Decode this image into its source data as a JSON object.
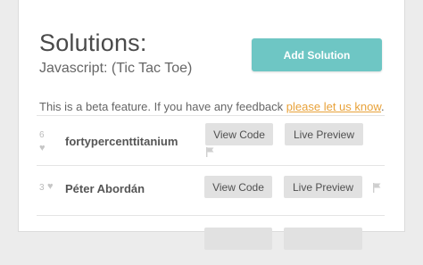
{
  "header": {
    "title": "Solutions:",
    "subtitle": "Javascript: (Tic Tac Toe)",
    "add_button": "Add Solution"
  },
  "beta": {
    "text": "This is a beta feature. If you have any feedback ",
    "link": "please let us know",
    "end": "."
  },
  "solutions": [
    {
      "votes": "6",
      "author": "fortypercenttitanium",
      "view_label": "View Code",
      "preview_label": "Live Preview"
    },
    {
      "votes": "3",
      "author": "Péter Abordán",
      "view_label": "View Code",
      "preview_label": "Live Preview"
    },
    {
      "votes": "",
      "author": "",
      "view_label": "",
      "preview_label": ""
    }
  ],
  "colors": {
    "accent": "#6ec6c4",
    "link": "#e8a23a",
    "button_bg": "#e1e1e1"
  }
}
